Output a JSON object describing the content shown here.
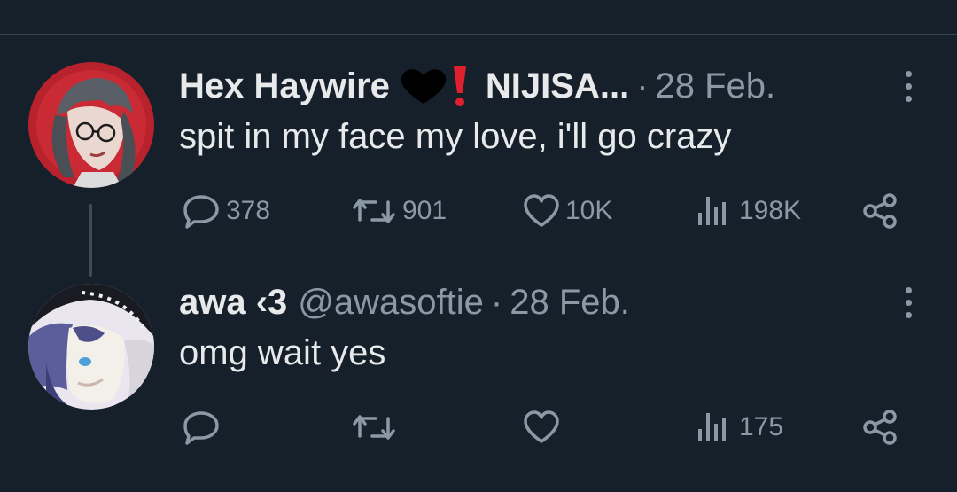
{
  "tweets": [
    {
      "display_name": "Hex Haywire",
      "name_suffix": "NIJISA...",
      "handle": "",
      "date": "28 Feb.",
      "text": "spit in my face my love, i'll go crazy",
      "counts": {
        "replies": "378",
        "retweets": "901",
        "likes": "10K",
        "views": "198K"
      }
    },
    {
      "display_name": "awa ‹3",
      "name_suffix": "",
      "handle": "@awasoftie",
      "date": "28 Feb.",
      "text": "omg wait yes",
      "counts": {
        "replies": "",
        "retweets": "",
        "likes": "",
        "views": "175"
      }
    }
  ],
  "separator": "·",
  "icons": {
    "reply": "reply-icon",
    "retweet": "retweet-icon",
    "like": "heart-icon",
    "views": "views-icon",
    "share": "share-icon",
    "more": "more-options-icon",
    "emoji_heart": "black-heart-icon",
    "emoji_exclamation": "red-exclamation-icon"
  },
  "colors": {
    "background": "#15202b",
    "text_primary": "#e7e9ea",
    "text_secondary": "#8b98a5",
    "divider": "#38444d",
    "exclamation": "#e0202f"
  }
}
